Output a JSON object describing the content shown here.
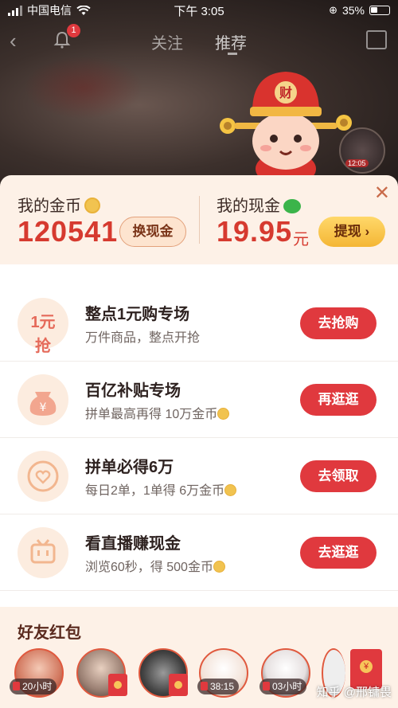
{
  "status_bar": {
    "carrier": "中国电信",
    "time": "下午 3:05",
    "battery": "35%"
  },
  "nav": {
    "notification_count": "1",
    "tabs": [
      "关注",
      "推荐"
    ],
    "active_tab": "推荐"
  },
  "wallet": {
    "coins_label": "我的金币",
    "coins_value": "120541",
    "exchange_button": "换现金",
    "cash_label": "我的现金",
    "cash_value": "19.95",
    "cash_unit": "元",
    "withdraw_button": "提现 ›"
  },
  "tasks": [
    {
      "title": "整点1元购专场",
      "subtitle": "万件商品，整点开抢",
      "button": "去抢购",
      "icon": "one-yuan-icon",
      "icon_text": "1元抢"
    },
    {
      "title": "百亿补贴专场",
      "subtitle": "拼单最高再得 10万金币",
      "button": "再逛逛",
      "icon": "money-bag-icon",
      "icon_text": ""
    },
    {
      "title": "拼单必得6万",
      "subtitle": "每日2单，1单得 6万金币",
      "button": "去领取",
      "icon": "heart-coin-icon",
      "icon_text": ""
    },
    {
      "title": "看直播赚现金",
      "subtitle": "浏览60秒，得 500金币",
      "button": "去逛逛",
      "icon": "tv-icon",
      "icon_text": ""
    }
  ],
  "friends": {
    "heading": "好友红包",
    "items": [
      {
        "time": "20小时"
      },
      {
        "time": ""
      },
      {
        "time": ""
      },
      {
        "time": "38:15"
      },
      {
        "time": "03小时"
      }
    ]
  },
  "watermark": "知乎 @邢镛畏",
  "colors": {
    "accent_red": "#e0393e",
    "amount_red": "#d63a2f",
    "card_bg": "#fdf1e7",
    "coin_gold": "#f1c350"
  }
}
